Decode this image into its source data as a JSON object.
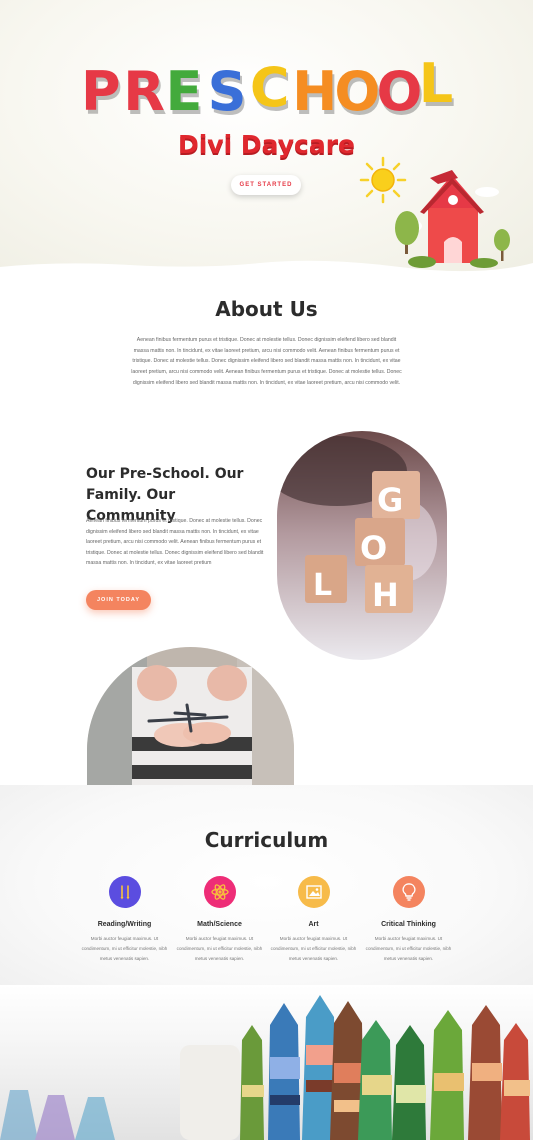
{
  "hero": {
    "title_letters": [
      "P",
      "R",
      "E",
      "S",
      "C",
      "H",
      "O",
      "O",
      "L"
    ],
    "title_colors": [
      "#e63946",
      "#e63946",
      "#43aa3c",
      "#3a6fd8",
      "#f5c518",
      "#f58d22",
      "#f58d22",
      "#e63946",
      "#f5c518"
    ],
    "subtitle": "Divi Daycare",
    "cta_label": "GET STARTED"
  },
  "about": {
    "title": "About Us",
    "body": "Aenean finibus fermentum purus et tristique. Donec at molestie tellus. Donec dignissim eleifend libero sed blandit massa mattis non. In tincidunt, ex vitae laoreet pretium, arcu nisi commodo velit. Aenean finibus fermentum purus et tristique. Donec at molestie tellus. Donec dignissim eleifend libero sed blandit massa mattis non. In tincidunt, ex vitae laoreet pretium, arcu nisi commodo velit. Aenean finibus fermentum purus et tristique. Donec at molestie tellus. Donec dignissim eleifend libero sed blandit massa mattis non. In tincidunt, ex vitae laoreet pretium, arcu nisi commodo velit."
  },
  "community": {
    "title": "Our Pre-School. Our Family. Our Community",
    "body": "Aenean finibus fermentum purus et tristique. Donec at molestie tellus. Donec dignissim eleifend libero sed blandit massa mattis non. In tincidunt, ex vitae laoreet pretium, arcu nisi commodo velit. Aenean finibus fermentum purus et tristique. Donec at molestie tellus. Donec dignissim eleifend libero sed blandit massa mattis non. In tincidunt, ex vitae laoreet pretium",
    "cta_label": "JOIN TODAY",
    "block_letters": [
      "G",
      "O",
      "H",
      "L"
    ]
  },
  "curriculum": {
    "title": "Curriculum",
    "items": [
      {
        "name": "Reading/Writing",
        "icon": "pencils-icon",
        "color": "#5b4de0",
        "desc": "Morbi auctor feugiat maximus. Ut condimentum, mi ut efficitur molestie, nibh metus venenatis sapien."
      },
      {
        "name": "Math/Science",
        "icon": "atom-icon",
        "color": "#ee2d77",
        "desc": "Morbi auctor feugiat maximus. Ut condimentum, mi ut efficitur molestie, nibh metus venenatis sapien."
      },
      {
        "name": "Art",
        "icon": "picture-icon",
        "color": "#f7bb4a",
        "desc": "Morbi auctor feugiat maximus. Ut condimentum, mi ut efficitur molestie, nibh metus venenatis sapien."
      },
      {
        "name": "Critical Thinking",
        "icon": "lightbulb-icon",
        "color": "#f4845f",
        "desc": "Morbi auctor feugiat maximus. Ut condimentum, mi ut efficitur molestie, nibh metus venenatis sapien."
      }
    ]
  }
}
